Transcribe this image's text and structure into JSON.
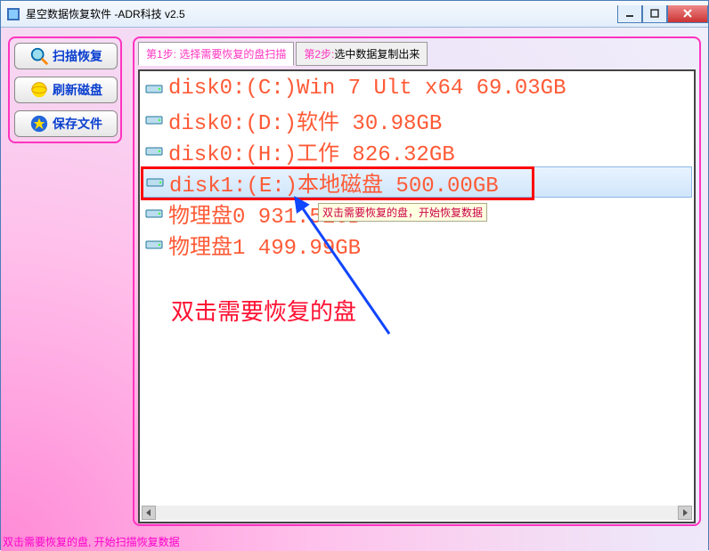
{
  "window": {
    "title": "星空数据恢复软件  -ADR科技 v2.5"
  },
  "sidebar": {
    "btn1": "扫描恢复",
    "btn2": "刷新磁盘",
    "btn3": "保存文件"
  },
  "tabs": {
    "step1_label": "第1步:",
    "step1_text": " 选择需要恢复的盘扫描",
    "step2_label": "第2步:",
    "step2_text": "选中数据复制出来"
  },
  "disks": [
    {
      "text": "disk0:(C:)Win 7 Ult x64 69.03GB",
      "selected": false
    },
    {
      "text": "disk0:(D:)软件 30.98GB",
      "selected": false
    },
    {
      "text": "disk0:(H:)工作 826.32GB",
      "selected": false
    },
    {
      "text": "disk1:(E:)本地磁盘 500.00GB",
      "selected": true
    },
    {
      "text": "物理盘0 931.51GB",
      "selected": false
    },
    {
      "text": "物理盘1 499.99GB",
      "selected": false
    }
  ],
  "tooltip": "双击需要恢复的盘，开始恢复数据",
  "annotation": "双击需要恢复的盘",
  "status": "双击需要恢复的盘, 开始扫描恢复数据"
}
